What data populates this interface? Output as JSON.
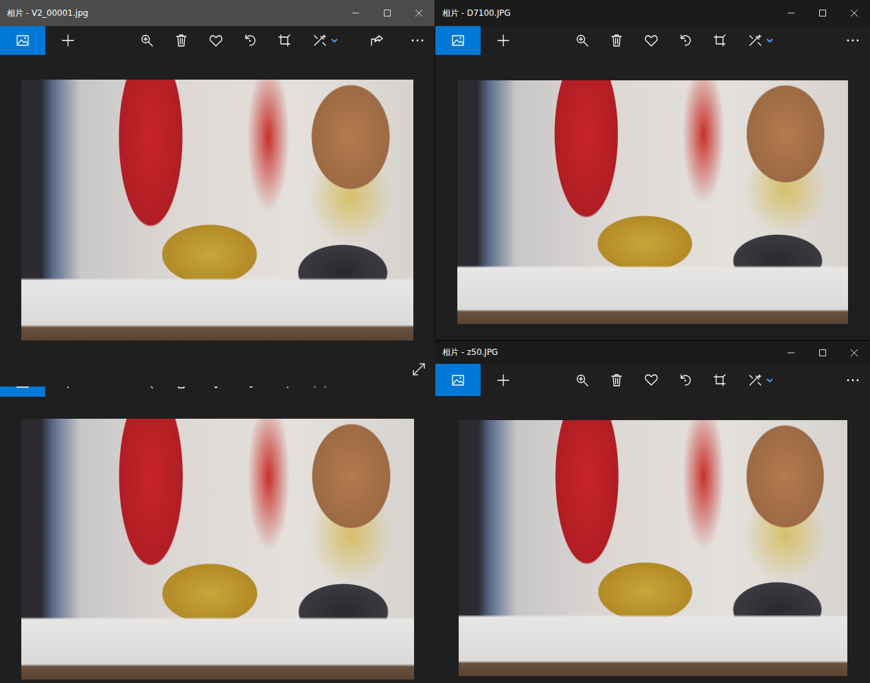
{
  "windows": [
    {
      "title": "相片 - V2_00001.jpg",
      "active": true,
      "share": true,
      "expand": true
    },
    {
      "title": "相片 - D7100.JPG",
      "active": false,
      "share": false,
      "expand": false
    },
    {
      "title": "",
      "active": false,
      "share": false,
      "expand": false
    },
    {
      "title": "相片 - z50.JPG",
      "active": false,
      "share": false,
      "expand": false
    }
  ]
}
